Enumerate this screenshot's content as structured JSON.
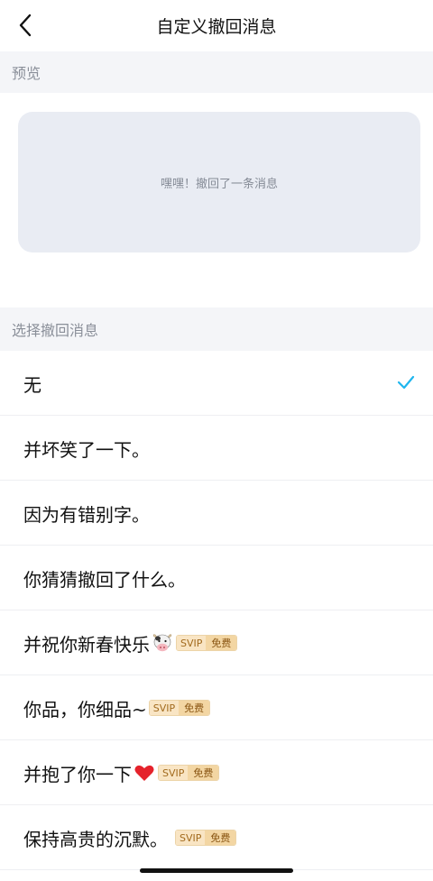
{
  "nav": {
    "title": "自定义撤回消息",
    "back_icon": "chevron-left-icon"
  },
  "preview": {
    "section_label": "预览",
    "message": "嘿嘿！撤回了一条消息"
  },
  "select": {
    "section_label": "选择撤回消息",
    "options": [
      {
        "label": "无",
        "selected": true
      },
      {
        "label": "并坏笑了一下。"
      },
      {
        "label": "因为有错别字。"
      },
      {
        "label": "你猜猜撤回了什么。"
      },
      {
        "label": "并祝你新春快乐",
        "emoji": "cow-face-icon",
        "badge": [
          "SVIP",
          "免费"
        ]
      },
      {
        "label": "你品，你细品~",
        "badge": [
          "SVIP",
          "免费"
        ]
      },
      {
        "label": "并抱了你一下",
        "emoji": "red-heart-icon",
        "badge": [
          "SVIP",
          "免费"
        ]
      },
      {
        "label": "保持高贵的沉默。",
        "badge": [
          "SVIP",
          "免费"
        ]
      }
    ]
  },
  "colors": {
    "check": "#1fb6ee",
    "section_bg": "#f4f5f8",
    "card_bg": "#e9ecf3"
  }
}
